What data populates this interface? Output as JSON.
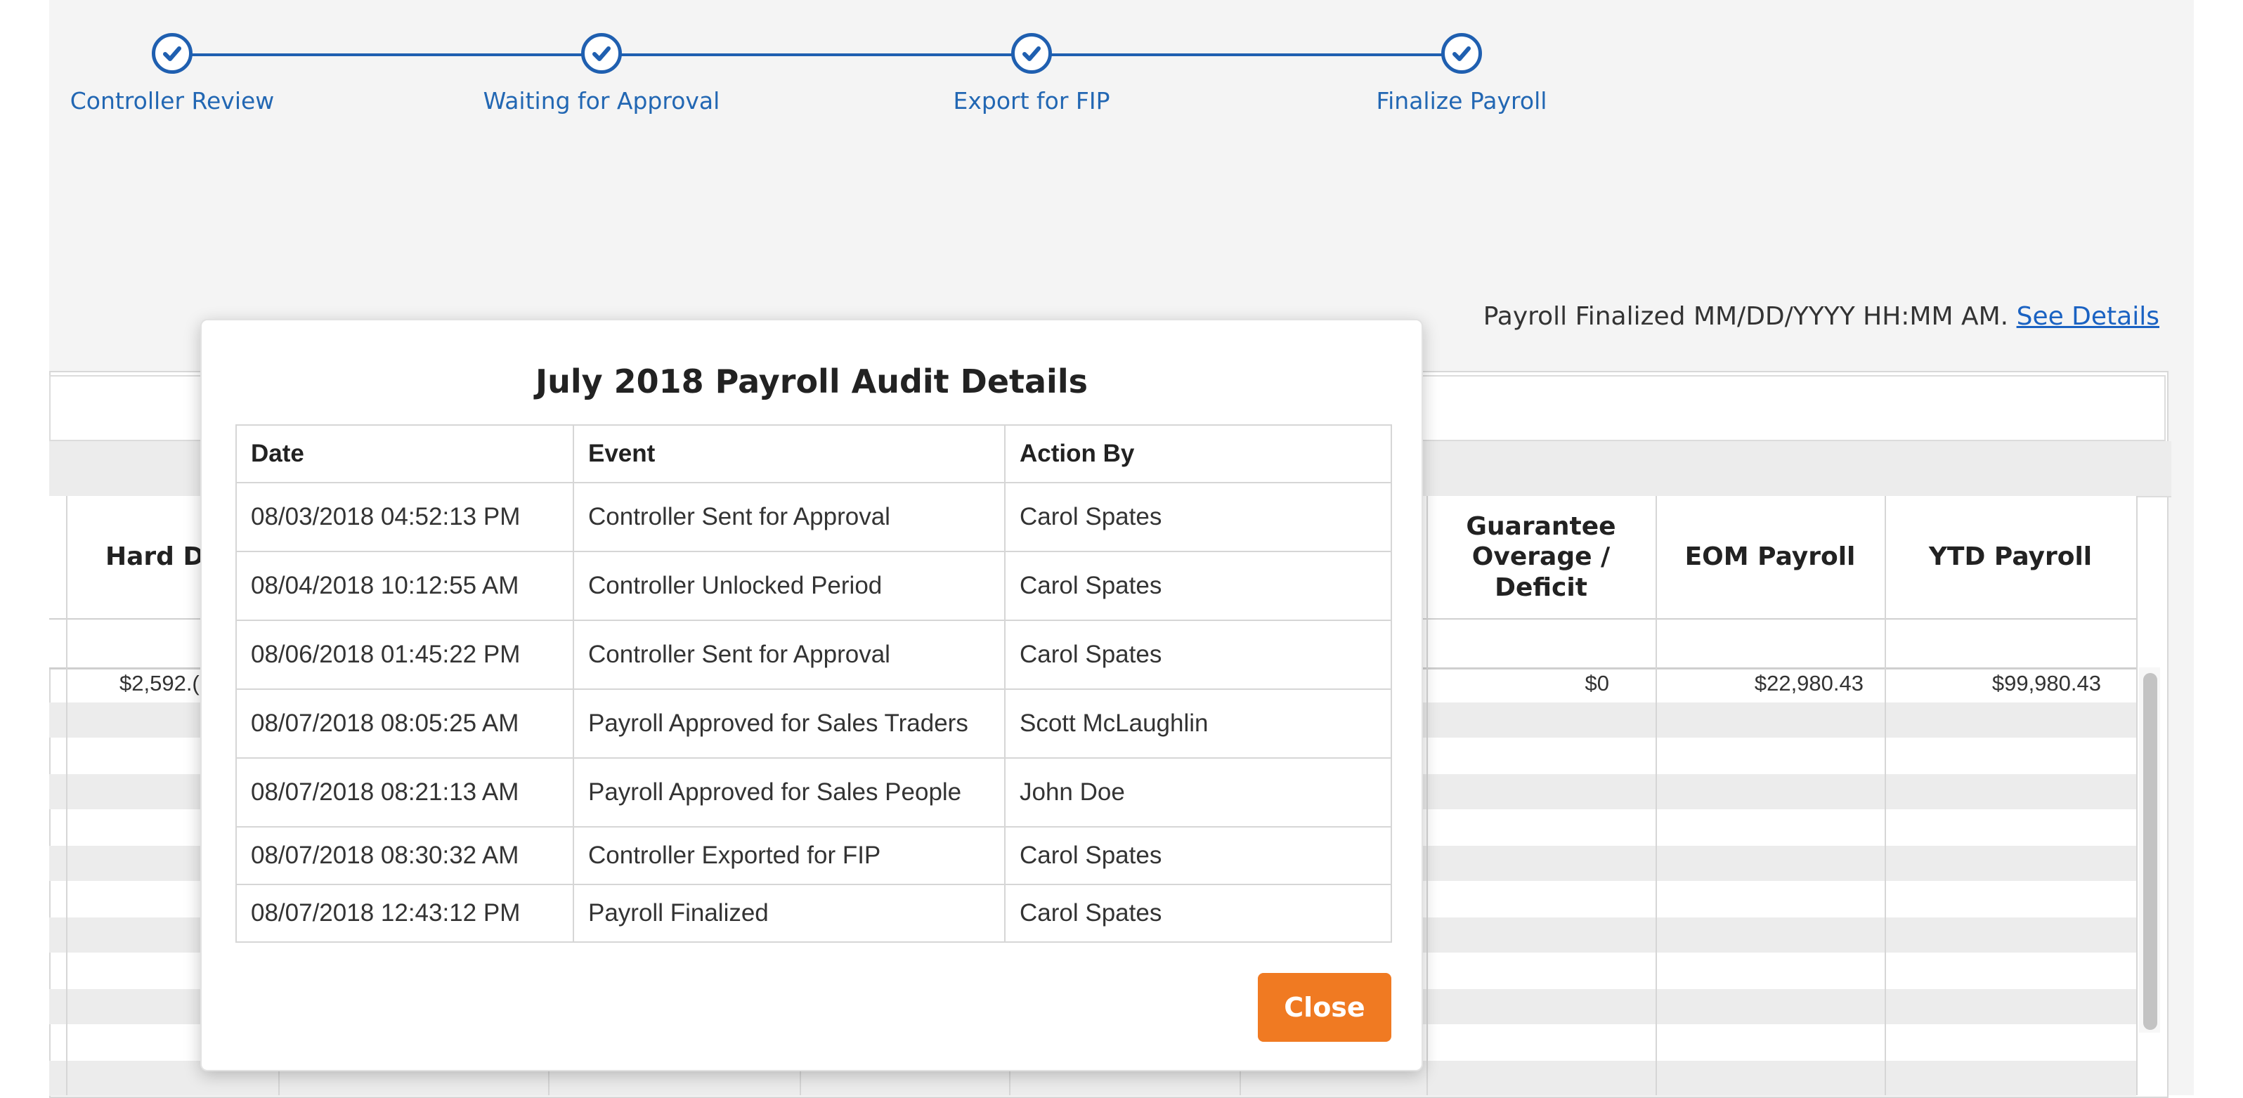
{
  "stepper": {
    "steps": [
      {
        "label": "Controller Review"
      },
      {
        "label": "Waiting for Approval"
      },
      {
        "label": "Export for FIP"
      },
      {
        "label": "Finalize Payroll"
      }
    ]
  },
  "status": {
    "finalized_text": "Payroll Finalized MM/DD/YYYY HH:MM AM.",
    "see_details_link": "See Details"
  },
  "grid": {
    "headers": {
      "hard_do": "Hard Do",
      "guarantee": "Guarantee Overage / Deficit",
      "eom": "EOM Payroll",
      "ytd": "YTD Payroll"
    },
    "row1": {
      "hard_do": "$2,592.(",
      "guarantee": "$0",
      "eom": "$22,980.43",
      "ytd": "$99,980.43"
    }
  },
  "modal": {
    "title": "July 2018 Payroll Audit Details",
    "columns": [
      "Date",
      "Event",
      "Action By"
    ],
    "rows": [
      [
        "08/03/2018 04:52:13 PM",
        "Controller Sent for Approval",
        "Carol Spates"
      ],
      [
        "08/04/2018 10:12:55 AM",
        "Controller Unlocked Period",
        "Carol Spates"
      ],
      [
        "08/06/2018 01:45:22 PM",
        "Controller Sent for Approval",
        "Carol Spates"
      ],
      [
        "08/07/2018 08:05:25 AM",
        "Payroll Approved for Sales Traders",
        "Scott McLaughlin"
      ],
      [
        "08/07/2018 08:21:13 AM",
        "Payroll Approved for Sales People",
        "John Doe"
      ],
      [
        "08/07/2018 08:30:32 AM",
        "Controller Exported for FIP",
        "Carol Spates"
      ],
      [
        "08/07/2018 12:43:12 PM",
        "Payroll Finalized",
        "Carol Spates"
      ]
    ],
    "close_label": "Close"
  },
  "colors": {
    "accent_blue": "#1f5fb0",
    "link_blue": "#1a62c2",
    "close_orange": "#f07a22"
  }
}
